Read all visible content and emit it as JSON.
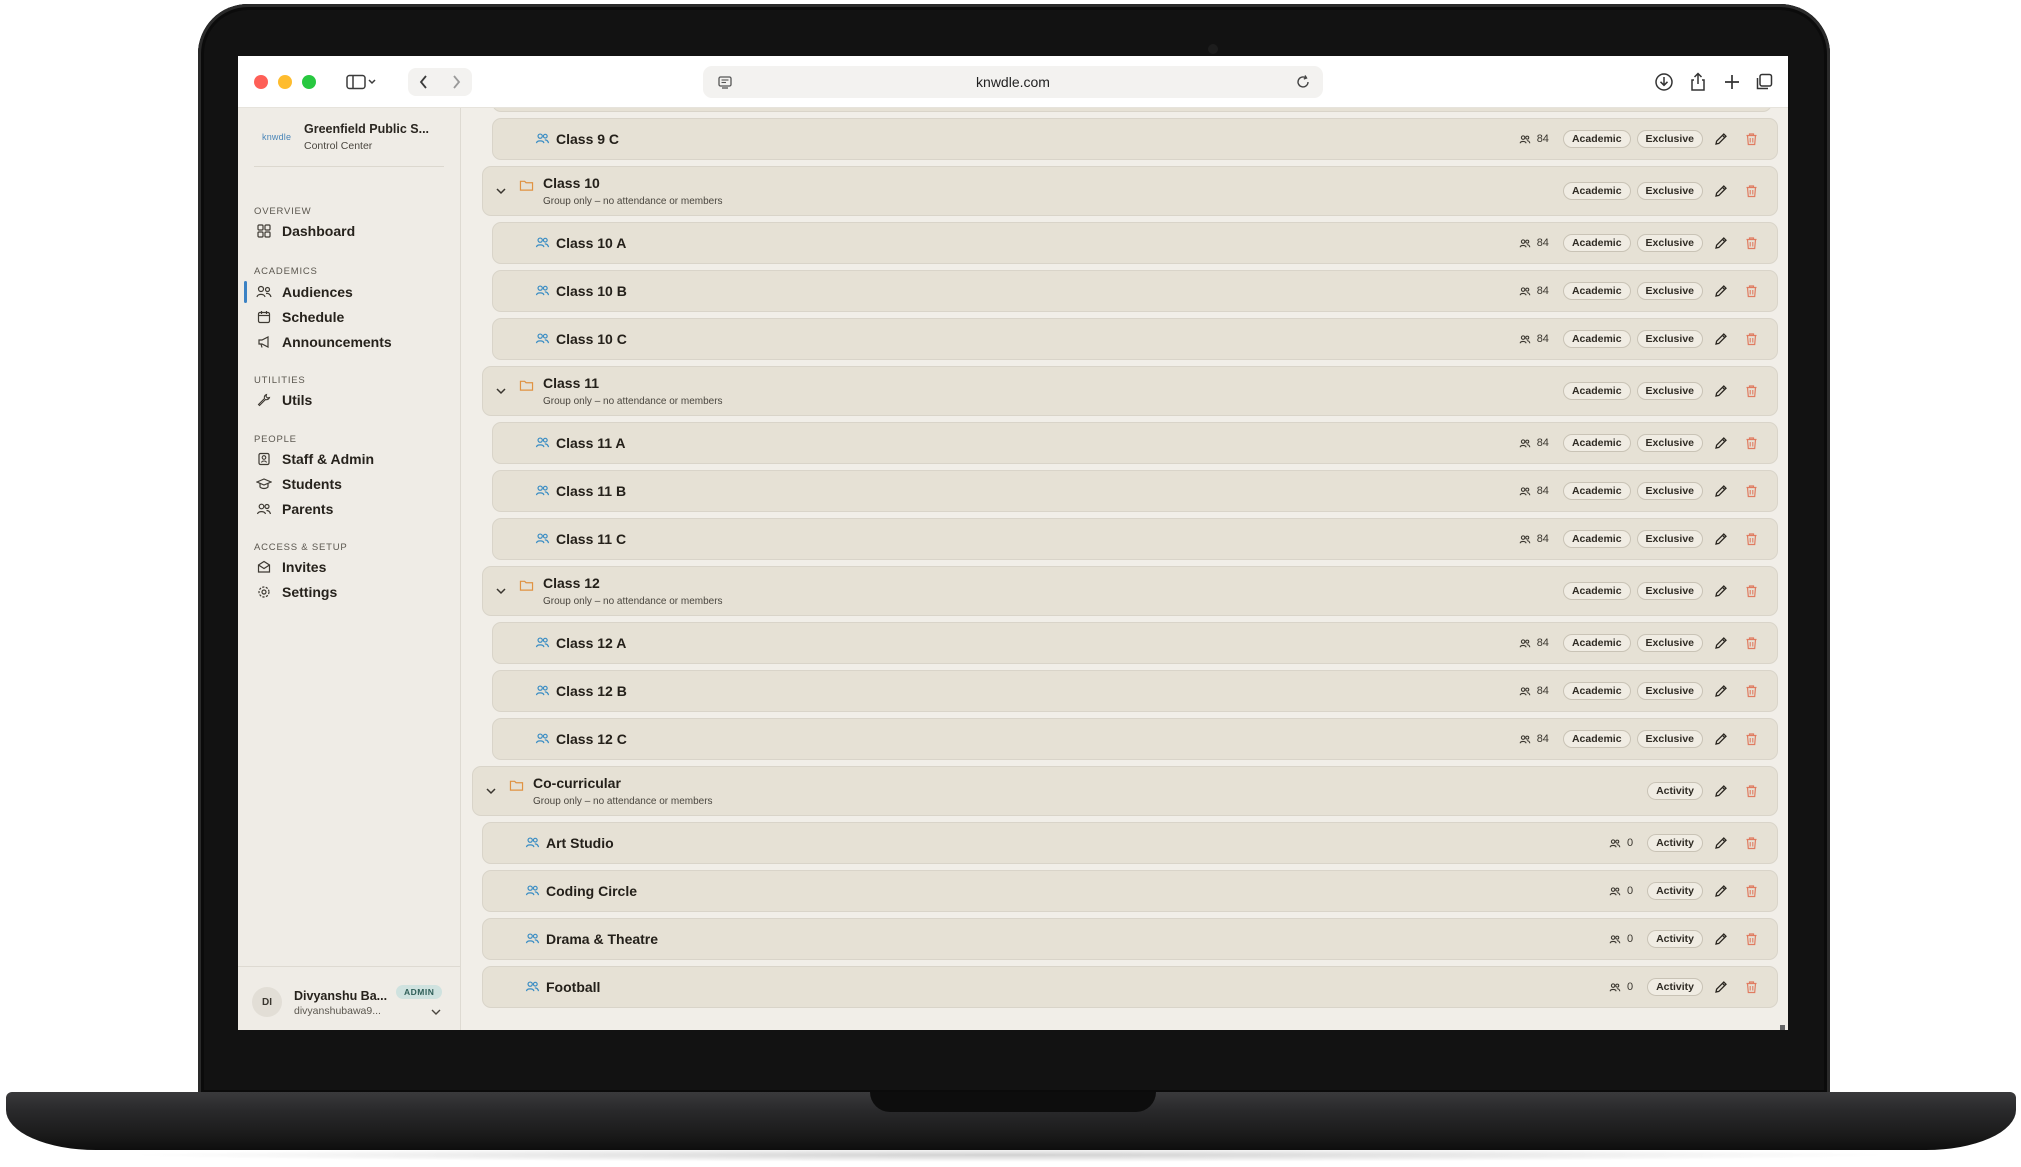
{
  "browser": {
    "url": "knwdle.com"
  },
  "sidebar": {
    "logo": "knwdle",
    "org_name": "Greenfield Public S...",
    "org_sub": "Control Center",
    "sections": [
      {
        "label": "OVERVIEW",
        "items": [
          {
            "label": "Dashboard",
            "icon": "dashboard-icon"
          }
        ]
      },
      {
        "label": "ACADEMICS",
        "items": [
          {
            "label": "Audiences",
            "icon": "audiences-icon",
            "active": true
          },
          {
            "label": "Schedule",
            "icon": "calendar-icon"
          },
          {
            "label": "Announcements",
            "icon": "megaphone-icon"
          }
        ]
      },
      {
        "label": "UTILITIES",
        "items": [
          {
            "label": "Utils",
            "icon": "wrench-icon"
          }
        ]
      },
      {
        "label": "PEOPLE",
        "items": [
          {
            "label": "Staff & Admin",
            "icon": "id-card-icon"
          },
          {
            "label": "Students",
            "icon": "graduation-icon"
          },
          {
            "label": "Parents",
            "icon": "users-icon"
          }
        ]
      },
      {
        "label": "ACCESS & SETUP",
        "items": [
          {
            "label": "Invites",
            "icon": "mail-icon"
          },
          {
            "label": "Settings",
            "icon": "gear-icon"
          }
        ]
      }
    ],
    "user": {
      "initials": "DI",
      "name": "Divyanshu Ba...",
      "email": "divyanshubawa9...",
      "badge": "ADMIN"
    }
  },
  "audiences": {
    "rows": [
      {
        "type": "child",
        "indent": 2,
        "name": "Class 9 C",
        "count": "84",
        "tags": [
          "Academic",
          "Exclusive"
        ]
      },
      {
        "type": "group",
        "indent": 1,
        "name": "Class 10",
        "subtitle": "Group only – no attendance or members",
        "tags": [
          "Academic",
          "Exclusive"
        ]
      },
      {
        "type": "child",
        "indent": 2,
        "name": "Class 10 A",
        "count": "84",
        "tags": [
          "Academic",
          "Exclusive"
        ]
      },
      {
        "type": "child",
        "indent": 2,
        "name": "Class 10 B",
        "count": "84",
        "tags": [
          "Academic",
          "Exclusive"
        ]
      },
      {
        "type": "child",
        "indent": 2,
        "name": "Class 10 C",
        "count": "84",
        "tags": [
          "Academic",
          "Exclusive"
        ]
      },
      {
        "type": "group",
        "indent": 1,
        "name": "Class 11",
        "subtitle": "Group only – no attendance or members",
        "tags": [
          "Academic",
          "Exclusive"
        ]
      },
      {
        "type": "child",
        "indent": 2,
        "name": "Class 11 A",
        "count": "84",
        "tags": [
          "Academic",
          "Exclusive"
        ]
      },
      {
        "type": "child",
        "indent": 2,
        "name": "Class 11 B",
        "count": "84",
        "tags": [
          "Academic",
          "Exclusive"
        ]
      },
      {
        "type": "child",
        "indent": 2,
        "name": "Class 11 C",
        "count": "84",
        "tags": [
          "Academic",
          "Exclusive"
        ]
      },
      {
        "type": "group",
        "indent": 1,
        "name": "Class 12",
        "subtitle": "Group only – no attendance or members",
        "tags": [
          "Academic",
          "Exclusive"
        ]
      },
      {
        "type": "child",
        "indent": 2,
        "name": "Class 12 A",
        "count": "84",
        "tags": [
          "Academic",
          "Exclusive"
        ]
      },
      {
        "type": "child",
        "indent": 2,
        "name": "Class 12 B",
        "count": "84",
        "tags": [
          "Academic",
          "Exclusive"
        ]
      },
      {
        "type": "child",
        "indent": 2,
        "name": "Class 12 C",
        "count": "84",
        "tags": [
          "Academic",
          "Exclusive"
        ]
      },
      {
        "type": "group",
        "indent": 0,
        "name": "Co-curricular",
        "subtitle": "Group only – no attendance or members",
        "tags": [
          "Activity"
        ]
      },
      {
        "type": "child",
        "indent": 1,
        "name": "Art Studio",
        "count": "0",
        "tags": [
          "Activity"
        ]
      },
      {
        "type": "child",
        "indent": 1,
        "name": "Coding Circle",
        "count": "0",
        "tags": [
          "Activity"
        ]
      },
      {
        "type": "child",
        "indent": 1,
        "name": "Drama & Theatre",
        "count": "0",
        "tags": [
          "Activity"
        ]
      },
      {
        "type": "child",
        "indent": 1,
        "name": "Football",
        "count": "0",
        "tags": [
          "Activity"
        ]
      }
    ]
  },
  "colors": {
    "accent": "#3b82c4",
    "folder": "#e09241",
    "delete": "#e07b60",
    "row_bg": "#e6e1d5",
    "badge_admin_bg": "#cfe2df"
  }
}
